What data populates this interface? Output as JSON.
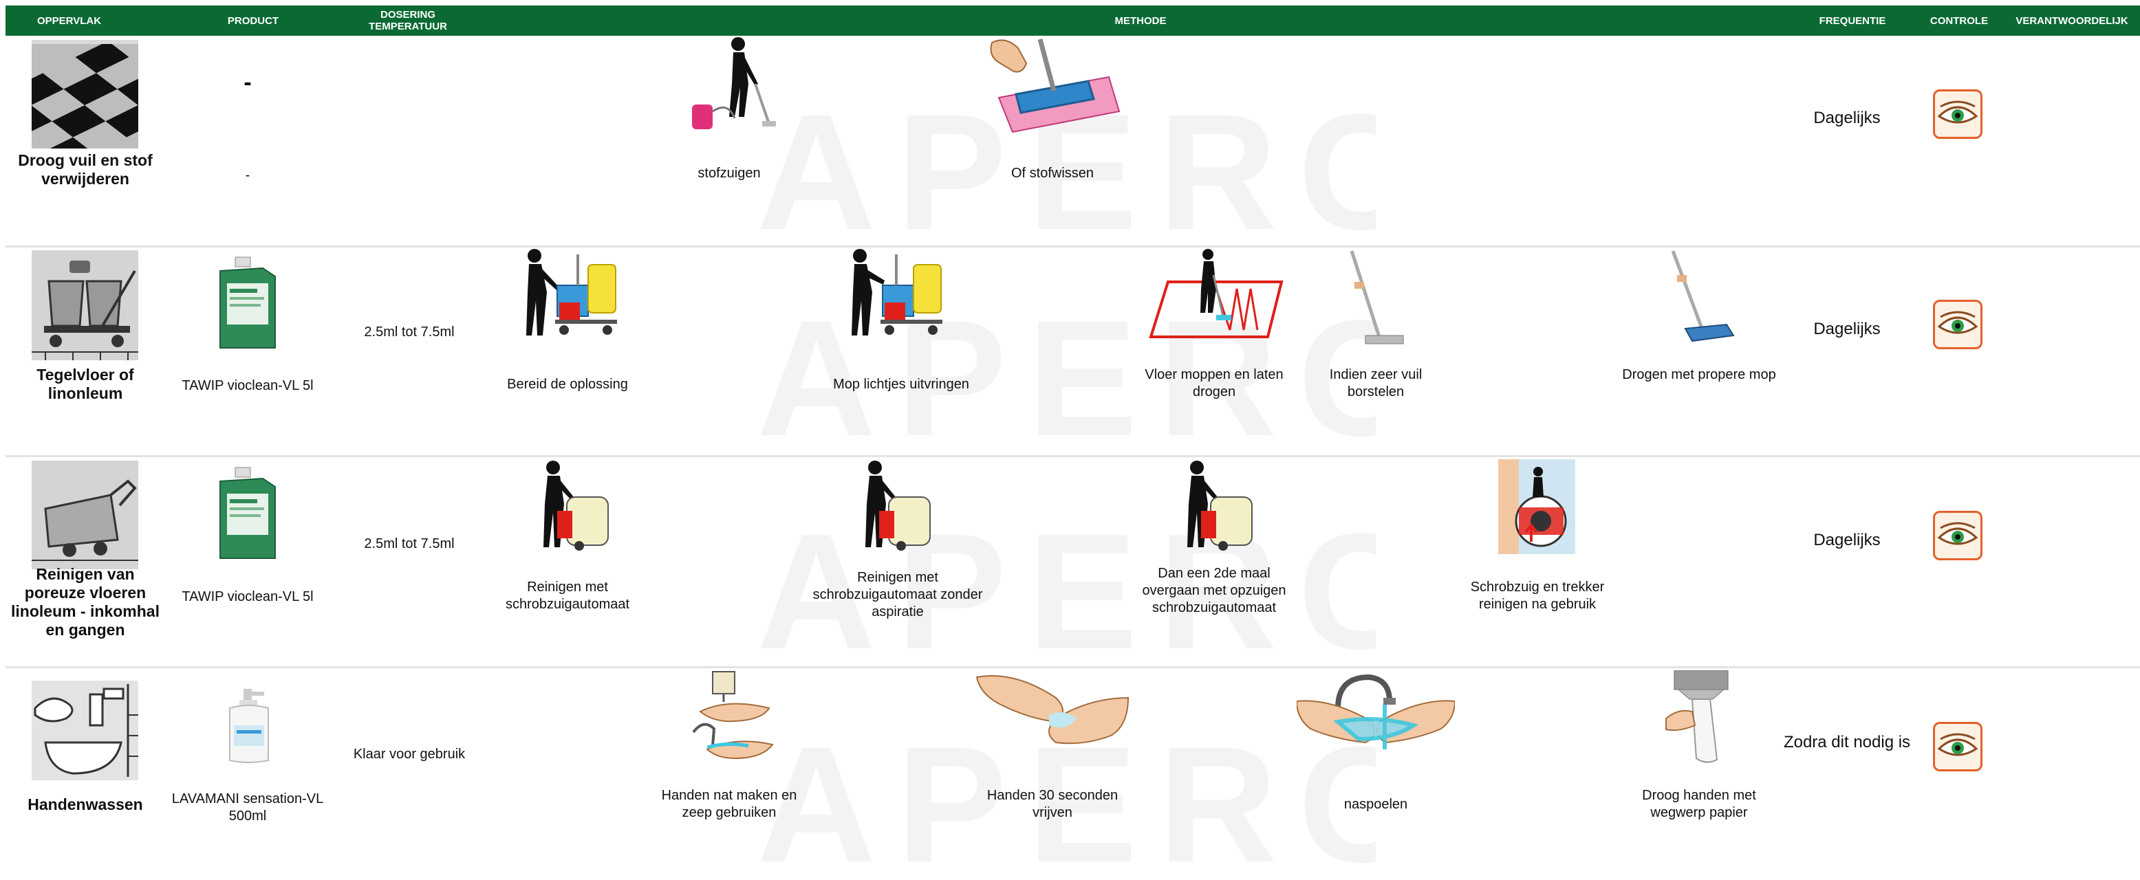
{
  "header": {
    "col_oppervlak": "OPPERVLAK",
    "col_product": "PRODUCT",
    "col_dosering": "DOSERING TEMPERATUUR",
    "col_methode": "METHODE",
    "col_frequentie": "FREQUENTIE",
    "col_controle": "CONTROLE",
    "col_verantwoordelijk": "VERANTWOORDELIJK"
  },
  "rows": [
    {
      "surface_label": "Droog vuil en stof verwijderen",
      "surface_icon": "checkered-floor-icon",
      "product_dash_top": "-",
      "product_label": "-",
      "dosage": "",
      "steps": [
        {
          "label": "stofzuigen",
          "icon": "vacuum-person-icon"
        },
        {
          "label": "Of stofwissen",
          "icon": "dust-mop-hand-icon"
        }
      ],
      "frequency": "Dagelijks",
      "control_icon": "eye-inspection-icon"
    },
    {
      "surface_label": "Tegelvloer of linonleum",
      "surface_icon": "cleaning-trolley-icon",
      "product_label": "TAWIP vioclean-VL 5l",
      "dosage": "2.5ml tot 7.5ml",
      "steps": [
        {
          "label": "Bereid de oplossing",
          "icon": "person-trolley-icon"
        },
        {
          "label": "Mop lichtjes uitvringen",
          "icon": "person-trolley-wring-icon"
        },
        {
          "label": "Vloer moppen en laten drogen",
          "icon": "mopping-pattern-icon"
        },
        {
          "label": "Indien zeer vuil borstelen",
          "icon": "floor-brush-icon"
        },
        {
          "label": "Drogen met propere mop",
          "icon": "flat-mop-icon"
        }
      ],
      "frequency": "Dagelijks",
      "control_icon": "eye-inspection-icon"
    },
    {
      "surface_label": "Reinigen van poreuze vloeren linoleum - inkomhal en gangen",
      "surface_icon": "scrubber-machine-icon",
      "product_label": "TAWIP vioclean-VL 5l",
      "dosage": "2.5ml tot 7.5ml",
      "steps": [
        {
          "label": "Reinigen met schrobzuigautomaat",
          "icon": "person-scrubber-icon"
        },
        {
          "label": "Reinigen met schrobzuigautomaat zonder aspiratie",
          "icon": "person-scrubber-icon"
        },
        {
          "label": "Dan een 2de maal overgaan met opzuigen schrobzuigautomaat",
          "icon": "person-scrubber-icon"
        },
        {
          "label": "Schrobzuig en trekker reinigen na gebruik",
          "icon": "scrubber-cleaning-icon"
        }
      ],
      "frequency": "Dagelijks",
      "control_icon": "eye-inspection-icon"
    },
    {
      "surface_label": "Handenwassen",
      "surface_icon": "handwash-sink-icon",
      "product_label": "LAVAMANI sensation-VL 500ml",
      "dosage": "Klaar voor gebruik",
      "steps": [
        {
          "label": "Handen nat maken en zeep gebruiken",
          "icon": "wet-hands-soap-icon"
        },
        {
          "label": "Handen 30 seconden vrijven",
          "icon": "rub-hands-icon"
        },
        {
          "label": "naspoelen",
          "icon": "rinse-hands-icon"
        },
        {
          "label": "Droog handen met wegwerp papier",
          "icon": "paper-towel-icon"
        }
      ],
      "frequency": "Zodra dit nodig is",
      "control_icon": "eye-inspection-icon"
    }
  ],
  "colors": {
    "header_bg": "#0b6a33",
    "header_text": "#ffffff",
    "row_separator": "#e3e3e3",
    "control_border": "#e3602a",
    "bottle_green": "#2e8b57",
    "mop_red": "#e0201a"
  }
}
